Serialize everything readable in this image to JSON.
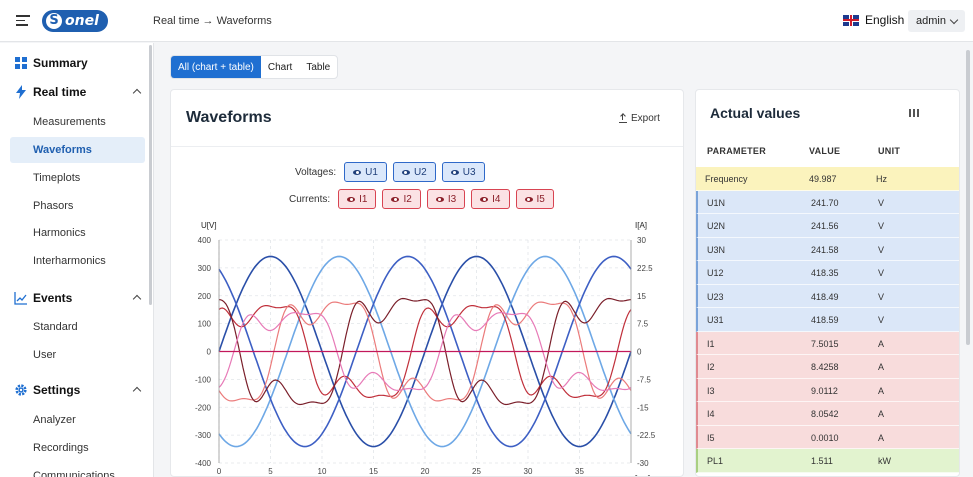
{
  "header": {
    "logo_text": "onel",
    "breadcrumb": "Real time → Waveforms",
    "language": "English",
    "user": "admin"
  },
  "sidebar": {
    "groups": [
      {
        "label": "Summary",
        "icon": "grid-icon"
      },
      {
        "label": "Real time",
        "icon": "lightning-icon"
      },
      {
        "label": "Events",
        "icon": "chart-line-icon"
      },
      {
        "label": "Settings",
        "icon": "gear-icon"
      }
    ],
    "items": [
      {
        "label": "Measurements"
      },
      {
        "label": "Waveforms"
      },
      {
        "label": "Timeplots"
      },
      {
        "label": "Phasors"
      },
      {
        "label": "Harmonics"
      },
      {
        "label": "Interharmonics"
      },
      {
        "label": "Standard"
      },
      {
        "label": "User"
      },
      {
        "label": "Analyzer"
      },
      {
        "label": "Recordings"
      },
      {
        "label": "Communications"
      }
    ]
  },
  "view_tabs": [
    {
      "label": "All (chart + table)"
    },
    {
      "label": "Chart"
    },
    {
      "label": "Table"
    }
  ],
  "waveforms": {
    "title": "Waveforms",
    "export_label": "Export",
    "voltages_label": "Voltages:",
    "currents_label": "Currents:",
    "voltage_chips": [
      "U1",
      "U2",
      "U3"
    ],
    "current_chips": [
      "I1",
      "I2",
      "I3",
      "I4",
      "I5"
    ]
  },
  "chart_data": {
    "type": "line",
    "xlabel": "[ms]",
    "ylabel_left": "U[V]",
    "ylabel_right": "I[A]",
    "x_range": [
      0,
      40
    ],
    "x_ticks": [
      "0",
      "5",
      "10",
      "15",
      "20",
      "25",
      "30",
      "35"
    ],
    "y_left_range": [
      -400,
      400
    ],
    "y_left_ticks": [
      "400",
      "300",
      "200",
      "100",
      "0",
      "-100",
      "-200",
      "-300",
      "-400"
    ],
    "y_right_range": [
      -30,
      30
    ],
    "y_right_ticks": [
      "30",
      "22.5",
      "15",
      "7.5",
      "0",
      "-7.5",
      "-15",
      "-22.5",
      "-30"
    ],
    "grid": true,
    "colors": {
      "U1": "#2a4fa8",
      "U2": "#6ea8e6",
      "U3": "#3d5fc4",
      "I1": "#c0303b",
      "I2": "#eb7b7b",
      "I3": "#7a1f2a",
      "I4": "#e77ab7",
      "I5": "#c2185b"
    },
    "series": [
      {
        "name": "U1",
        "axis": "left",
        "amplitude": 341,
        "period_ms": 20,
        "phase_deg": 0
      },
      {
        "name": "U2",
        "axis": "left",
        "amplitude": 341,
        "period_ms": 20,
        "phase_deg": -120
      },
      {
        "name": "U3",
        "axis": "left",
        "amplitude": 341,
        "period_ms": 20,
        "phase_deg": 120
      },
      {
        "name": "I1",
        "axis": "right",
        "amplitude": 13,
        "period_ms": 20,
        "phase_deg": 20
      },
      {
        "name": "I2",
        "axis": "right",
        "amplitude": 14,
        "period_ms": 20,
        "phase_deg": -100
      },
      {
        "name": "I3",
        "axis": "right",
        "amplitude": 15,
        "period_ms": 20,
        "phase_deg": 140
      },
      {
        "name": "I4",
        "axis": "right",
        "amplitude": 11,
        "period_ms": 20,
        "phase_deg": -30
      },
      {
        "name": "I5",
        "axis": "right",
        "amplitude": 0,
        "period_ms": 20,
        "phase_deg": 0
      }
    ]
  },
  "actual_values": {
    "title": "Actual values",
    "headers": {
      "parameter": "PARAMETER",
      "value": "VALUE",
      "unit": "UNIT"
    },
    "rows": [
      {
        "parameter": "Frequency",
        "value": "49.987",
        "unit": "Hz",
        "kind": "freq"
      },
      {
        "parameter": "U1N",
        "value": "241.70",
        "unit": "V",
        "kind": "volt"
      },
      {
        "parameter": "U2N",
        "value": "241.56",
        "unit": "V",
        "kind": "volt"
      },
      {
        "parameter": "U3N",
        "value": "241.58",
        "unit": "V",
        "kind": "volt"
      },
      {
        "parameter": "U12",
        "value": "418.35",
        "unit": "V",
        "kind": "volt"
      },
      {
        "parameter": "U23",
        "value": "418.49",
        "unit": "V",
        "kind": "volt"
      },
      {
        "parameter": "U31",
        "value": "418.59",
        "unit": "V",
        "kind": "volt"
      },
      {
        "parameter": "I1",
        "value": "7.5015",
        "unit": "A",
        "kind": "curr"
      },
      {
        "parameter": "I2",
        "value": "8.4258",
        "unit": "A",
        "kind": "curr"
      },
      {
        "parameter": "I3",
        "value": "9.0112",
        "unit": "A",
        "kind": "curr"
      },
      {
        "parameter": "I4",
        "value": "8.0542",
        "unit": "A",
        "kind": "curr"
      },
      {
        "parameter": "I5",
        "value": "0.0010",
        "unit": "A",
        "kind": "curr"
      },
      {
        "parameter": "PL1",
        "value": "1.511",
        "unit": "kW",
        "kind": "pow"
      }
    ]
  }
}
